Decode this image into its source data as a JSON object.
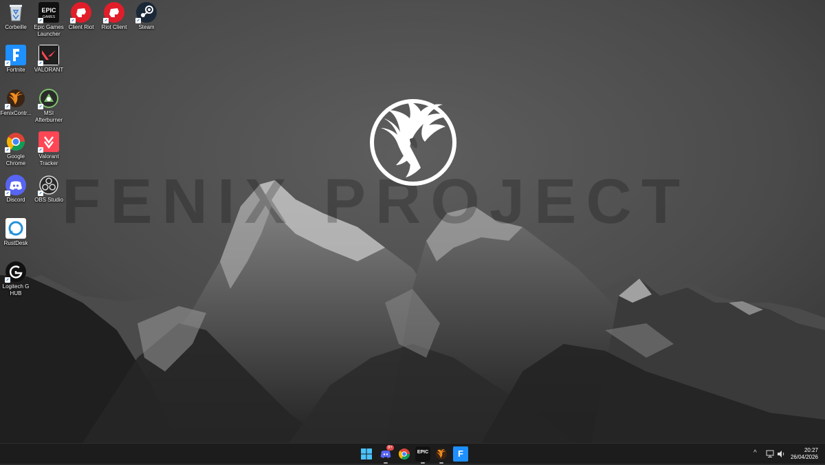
{
  "desktop": {
    "icons": [
      {
        "label": "Corbeille",
        "icon": "recycle-bin-icon"
      },
      {
        "label": "Epic Games Launcher",
        "icon": "epic-games-icon"
      },
      {
        "label": "Client Riot",
        "icon": "riot-client-icon"
      },
      {
        "label": "Riot Client",
        "icon": "riot-client-icon"
      },
      {
        "label": "Steam",
        "icon": "steam-icon"
      },
      {
        "label": "Fortnite",
        "icon": "fortnite-icon"
      },
      {
        "label": "VALORANT",
        "icon": "valorant-icon"
      },
      {
        "label": "FenixContr...",
        "icon": "fenix-icon"
      },
      {
        "label": "MSI Afterburner",
        "icon": "msi-afterburner-icon"
      },
      {
        "label": "Google Chrome",
        "icon": "chrome-icon"
      },
      {
        "label": "Valorant Tracker",
        "icon": "valorant-tracker-icon"
      },
      {
        "label": "Discord",
        "icon": "discord-icon"
      },
      {
        "label": "OBS Studio",
        "icon": "obs-icon"
      },
      {
        "label": "RustDesk",
        "icon": "rustdesk-icon"
      },
      {
        "label": "Logitech G HUB",
        "icon": "logitech-ghub-icon"
      }
    ]
  },
  "wallpaper": {
    "watermark_text": "FENIX PROJECT",
    "emblem": "phoenix-emblem"
  },
  "taskbar": {
    "apps": [
      {
        "name": "Start",
        "icon": "windows-start-icon"
      },
      {
        "name": "Discord",
        "icon": "discord-icon",
        "badge": "9+"
      },
      {
        "name": "Google Chrome",
        "icon": "chrome-icon"
      },
      {
        "name": "Epic Games Launcher",
        "icon": "epic-games-icon",
        "badge_text": "EPIC"
      },
      {
        "name": "FenixControl",
        "icon": "fenix-icon"
      },
      {
        "name": "Fortnite",
        "icon": "fortnite-icon",
        "badge_text": "F"
      }
    ],
    "tray": {
      "chevron": "^",
      "time": "20:27",
      "date": "26/04/2026"
    }
  },
  "colors": {
    "taskbar": "#1c1c1c",
    "riot_red": "#e11d2a",
    "discord": "#5865f2",
    "steam": "#1b2838",
    "fortnite": "#1e90ff"
  }
}
